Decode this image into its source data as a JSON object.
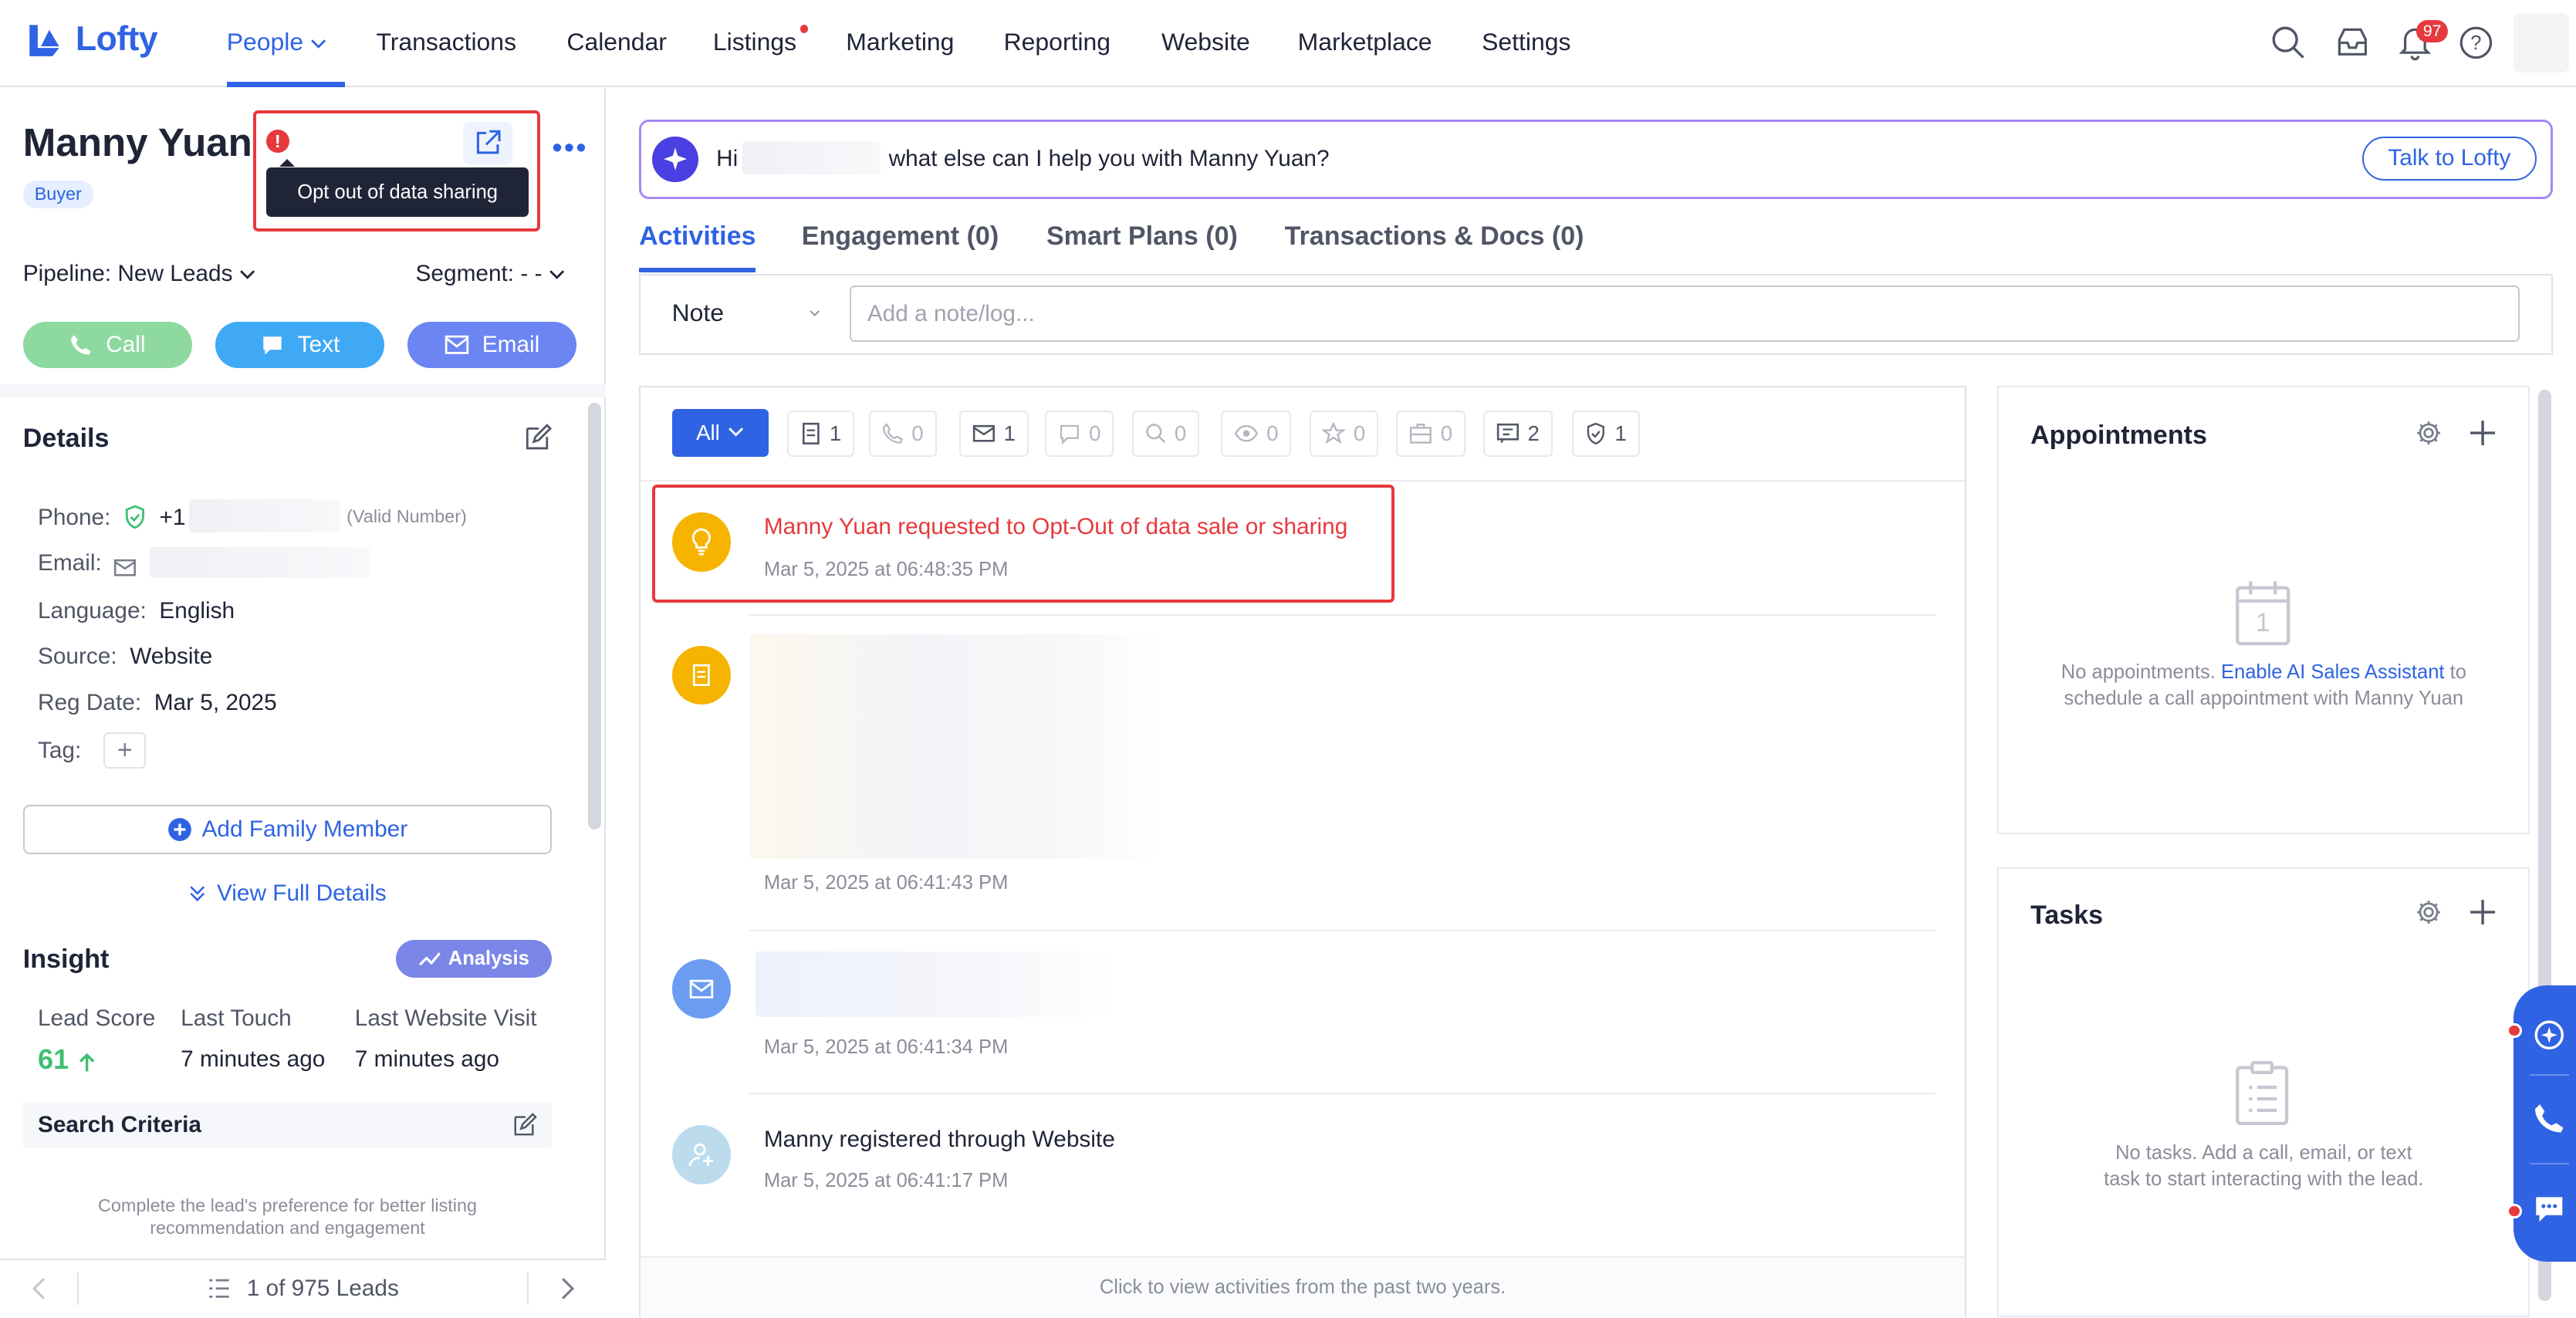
{
  "brand": {
    "name": "Lofty",
    "accent": "#2f63e3"
  },
  "nav": {
    "items": [
      "People",
      "Transactions",
      "Calendar",
      "Listings",
      "Marketing",
      "Reporting",
      "Website",
      "Marketplace",
      "Settings"
    ],
    "active": "People",
    "notification_count": "97"
  },
  "lead": {
    "name": "Manny Yuan",
    "tag": "Buyer",
    "tooltip": "Opt out of data sharing",
    "pipeline_label": "Pipeline:",
    "pipeline_value": "New Leads",
    "segment_label": "Segment:",
    "segment_value": "- -",
    "actions": {
      "call": "Call",
      "text": "Text",
      "email": "Email"
    }
  },
  "details": {
    "title": "Details",
    "phone_label": "Phone:",
    "phone_prefix": "+1",
    "phone_note": "(Valid Number)",
    "email_label": "Email:",
    "language_label": "Language:",
    "language_value": "English",
    "source_label": "Source:",
    "source_value": "Website",
    "regdate_label": "Reg Date:",
    "regdate_value": "Mar 5, 2025",
    "tag_label": "Tag:",
    "add_family": "Add Family Member",
    "view_full": "View Full Details"
  },
  "insight": {
    "title": "Insight",
    "analysis": "Analysis",
    "lead_score_label": "Lead Score",
    "lead_score": "61",
    "last_touch_label": "Last Touch",
    "last_touch": "7 minutes ago",
    "last_visit_label": "Last Website Visit",
    "last_visit": "7 minutes ago",
    "search_criteria": "Search Criteria",
    "criteria_hint": "Complete the lead's preference for better listing recommendation and engagement"
  },
  "pager": {
    "text": "1 of 975 Leads"
  },
  "ai": {
    "hi": "Hi",
    "prompt": "what else can I help you with Manny Yuan?",
    "button": "Talk to Lofty"
  },
  "tabs": [
    "Activities",
    "Engagement (0)",
    "Smart Plans (0)",
    "Transactions & Docs (0)"
  ],
  "note": {
    "type": "Note",
    "placeholder": "Add a note/log..."
  },
  "filters": {
    "all": "All",
    "counts": [
      {
        "icon": "document-icon",
        "count": "1",
        "on": true
      },
      {
        "icon": "phone-icon",
        "count": "0",
        "on": false
      },
      {
        "icon": "mail-icon",
        "count": "1",
        "on": true
      },
      {
        "icon": "chat-icon",
        "count": "0",
        "on": false
      },
      {
        "icon": "search-icon",
        "count": "0",
        "on": false
      },
      {
        "icon": "eye-icon",
        "count": "0",
        "on": false
      },
      {
        "icon": "star-icon",
        "count": "0",
        "on": false
      },
      {
        "icon": "briefcase-icon",
        "count": "0",
        "on": false
      },
      {
        "icon": "message-icon",
        "count": "2",
        "on": true
      },
      {
        "icon": "shield-icon",
        "count": "1",
        "on": true
      }
    ]
  },
  "activities": [
    {
      "title": "Manny Yuan requested to Opt-Out of data sale or sharing",
      "time": "Mar 5, 2025 at 06:48:35 PM",
      "color": "#f6b400",
      "icon": "lightbulb-icon"
    },
    {
      "title": "",
      "time": "Mar 5, 2025 at 06:41:43 PM",
      "color": "#f6b400",
      "icon": "document-icon"
    },
    {
      "title": "",
      "time": "Mar 5, 2025 at 06:41:34 PM",
      "color": "#6b9cf2",
      "icon": "mail-icon"
    },
    {
      "title": "Manny registered through Website",
      "time": "Mar 5, 2025 at 06:41:17 PM",
      "color": "#a9cde6",
      "icon": "user-add-icon"
    }
  ],
  "activity_footer": "Click to view activities from the past two years.",
  "appointments": {
    "title": "Appointments",
    "empty_pre": "No appointments.",
    "empty_link": "Enable AI Sales Assistant",
    "empty_post": "to schedule a call appointment with Manny Yuan",
    "calendar_day": "1"
  },
  "tasks": {
    "title": "Tasks",
    "empty": "No tasks. Add a call, email, or text task to start interacting with the lead."
  }
}
